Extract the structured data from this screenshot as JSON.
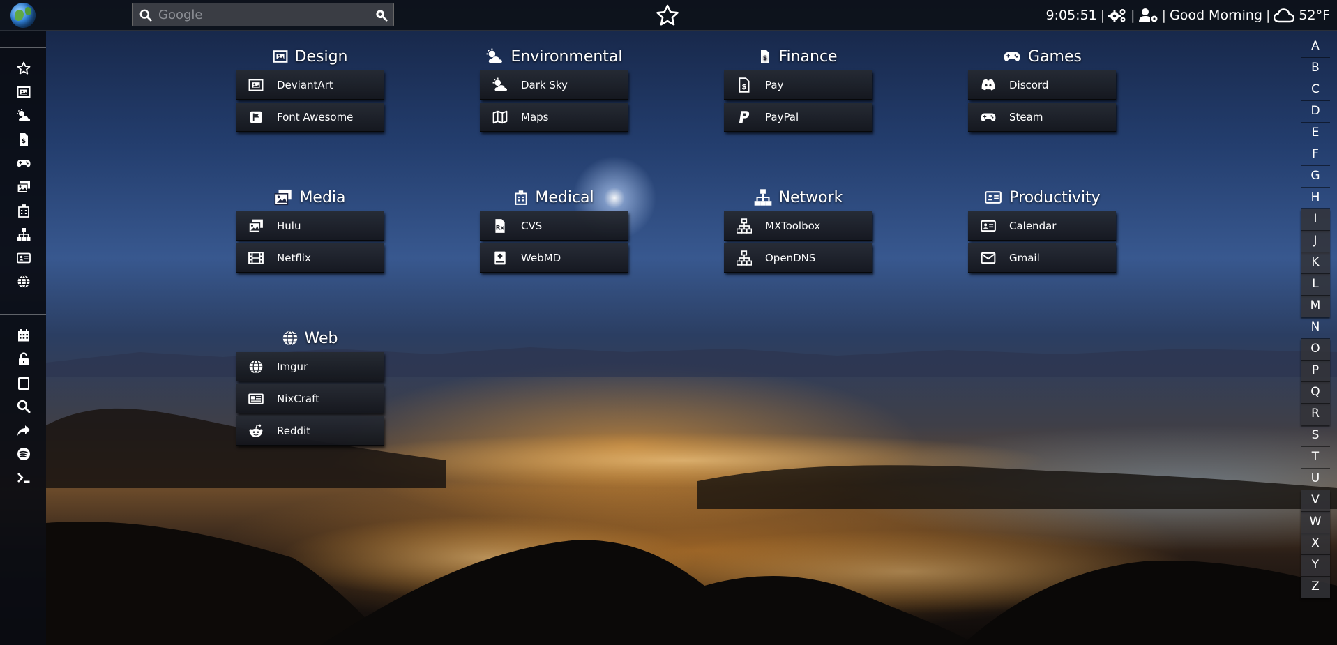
{
  "topbar": {
    "search_placeholder": "Google",
    "time": "9:05:51",
    "greeting": "Good Morning",
    "temperature": "52°F",
    "separator": "|"
  },
  "sidebar": {
    "top_icons": [
      "star-icon",
      "image-icon",
      "cloud-sun-icon",
      "dollar-file-icon",
      "gamepad-icon",
      "images-icon",
      "hospital-icon",
      "network-icon",
      "id-card-icon",
      "globe-icon"
    ],
    "bottom_icons": [
      "calendar-icon",
      "unlock-icon",
      "clipboard-icon",
      "search-icon",
      "share-icon",
      "spotify-icon",
      "terminal-icon"
    ]
  },
  "alphabet": [
    "A",
    "B",
    "C",
    "D",
    "E",
    "F",
    "G",
    "H",
    "I",
    "J",
    "K",
    "L",
    "M",
    "N",
    "O",
    "P",
    "Q",
    "R",
    "S",
    "T",
    "U",
    "V",
    "W",
    "X",
    "Y",
    "Z"
  ],
  "categories": [
    {
      "title": "Design",
      "icon": "image-icon",
      "links": [
        {
          "label": "DeviantArt",
          "icon": "image-icon"
        },
        {
          "label": "Font Awesome",
          "icon": "flag-icon"
        }
      ]
    },
    {
      "title": "Environmental",
      "icon": "cloud-sun-icon",
      "links": [
        {
          "label": "Dark Sky",
          "icon": "cloud-sun-icon"
        },
        {
          "label": "Maps",
          "icon": "map-icon"
        }
      ]
    },
    {
      "title": "Finance",
      "icon": "dollar-file-icon",
      "links": [
        {
          "label": "Pay",
          "icon": "dollar-file-icon"
        },
        {
          "label": "PayPal",
          "icon": "paypal-icon"
        }
      ]
    },
    {
      "title": "Games",
      "icon": "gamepad-icon",
      "links": [
        {
          "label": "Discord",
          "icon": "discord-icon"
        },
        {
          "label": "Steam",
          "icon": "gamepad-icon"
        }
      ]
    },
    {
      "title": "Media",
      "icon": "images-icon",
      "links": [
        {
          "label": "Hulu",
          "icon": "images-icon"
        },
        {
          "label": "Netflix",
          "icon": "film-icon"
        }
      ]
    },
    {
      "title": "Medical",
      "icon": "hospital-icon",
      "links": [
        {
          "label": "CVS",
          "icon": "prescription-icon"
        },
        {
          "label": "WebMD",
          "icon": "medical-book-icon"
        }
      ]
    },
    {
      "title": "Network",
      "icon": "network-icon",
      "links": [
        {
          "label": "MXToolbox",
          "icon": "network-icon"
        },
        {
          "label": "OpenDNS",
          "icon": "network-icon"
        }
      ]
    },
    {
      "title": "Productivity",
      "icon": "id-card-icon",
      "links": [
        {
          "label": "Calendar",
          "icon": "id-card-icon"
        },
        {
          "label": "Gmail",
          "icon": "envelope-icon"
        }
      ]
    },
    {
      "title": "Web",
      "icon": "globe-icon",
      "links": [
        {
          "label": "Imgur",
          "icon": "globe-icon"
        },
        {
          "label": "NixCraft",
          "icon": "newspaper-icon"
        },
        {
          "label": "Reddit",
          "icon": "reddit-icon"
        }
      ]
    }
  ]
}
